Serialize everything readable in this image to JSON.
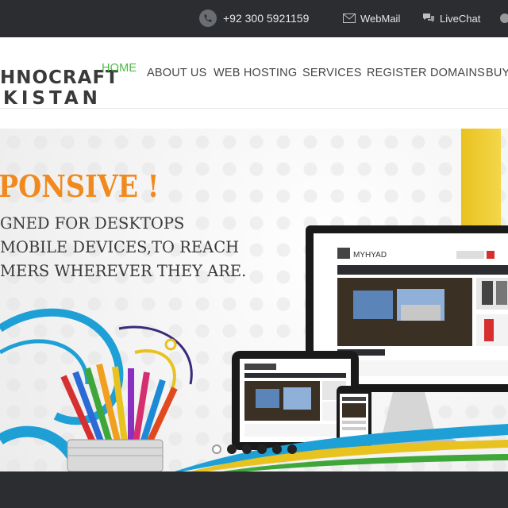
{
  "topbar": {
    "phone": "+92 300 5921159",
    "webmail": "WebMail",
    "livechat": "LiveChat",
    "phone_icon": "phone-icon",
    "mail_icon": "mail-icon",
    "chat_icon": "chat-icon"
  },
  "logo": {
    "line1": "HNOCRAFT",
    "line2": "KISTAN"
  },
  "nav": {
    "items": [
      "HOME",
      "ABOUT US",
      "WEB HOSTING",
      "SERVICES",
      "REGISTER DOMAINS",
      "BUY"
    ],
    "active_index": 0
  },
  "hero": {
    "headline": "PONSIVE !",
    "line1": "GNED FOR DESKTOPS",
    "line2": "MOBILE DEVICES,TO REACH",
    "line3": "MERS WHEREVER THEY ARE.",
    "slide_count": 6,
    "active_slide": 0,
    "mockup_brand": "MYHYAD"
  },
  "colors": {
    "accent_green": "#4db848",
    "headline_orange": "#f08a1e",
    "topbar_bg": "#2b2d31"
  }
}
